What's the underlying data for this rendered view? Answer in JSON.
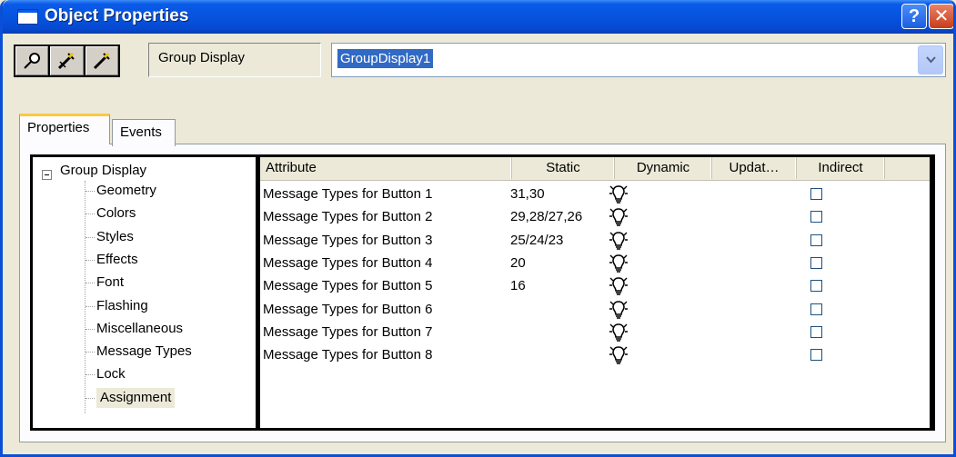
{
  "window": {
    "title": "Object Properties",
    "help_label": "?",
    "close_label": "✕"
  },
  "toolbar": {
    "pin_buttons": [
      "pin-icon",
      "pin-edit-icon",
      "pin-edit-alt-icon"
    ],
    "object_type": "Group Display",
    "object_name": "GroupDisplay1"
  },
  "tabs": {
    "properties": "Properties",
    "events": "Events"
  },
  "tree": {
    "root": "Group Display",
    "children": [
      "Geometry",
      "Colors",
      "Styles",
      "Effects",
      "Font",
      "Flashing",
      "Miscellaneous",
      "Message Types",
      "Lock",
      "Assignment"
    ],
    "selected": "Assignment"
  },
  "grid": {
    "columns": [
      "Attribute",
      "Static",
      "Dynamic",
      "Updat…",
      "Indirect"
    ],
    "rows": [
      {
        "attribute": "Message Types for Button 1",
        "static": "31,30",
        "indirect": false
      },
      {
        "attribute": "Message Types for Button 2",
        "static": "29,28/27,26",
        "indirect": false
      },
      {
        "attribute": "Message Types for Button 3",
        "static": "25/24/23",
        "indirect": false
      },
      {
        "attribute": "Message Types for Button 4",
        "static": "20",
        "indirect": false
      },
      {
        "attribute": "Message Types for Button 5",
        "static": "16",
        "indirect": false
      },
      {
        "attribute": "Message Types for Button 6",
        "static": "",
        "indirect": false
      },
      {
        "attribute": "Message Types for Button 7",
        "static": "",
        "indirect": false
      },
      {
        "attribute": "Message Types for Button 8",
        "static": "",
        "indirect": false
      }
    ],
    "dynamic_icon": "lightbulb-icon"
  },
  "colors": {
    "titlebar": "#0654de",
    "selection": "#316ac5",
    "window": "#ece9d8"
  }
}
